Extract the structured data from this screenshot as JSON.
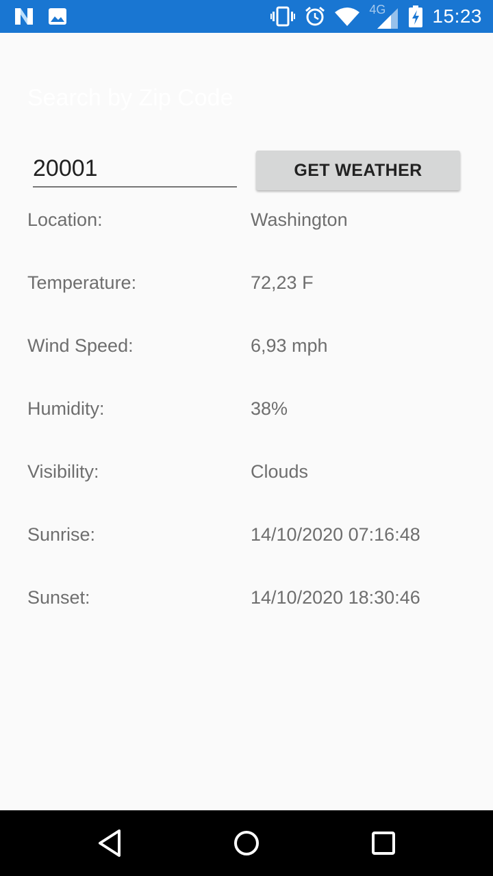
{
  "status_bar": {
    "time": "15:23",
    "network": "4G",
    "icons": [
      "n-logo-icon",
      "image-icon",
      "vibrate-icon",
      "alarm-icon",
      "wifi-icon",
      "signal-icon",
      "battery-charging-icon"
    ],
    "color": "#1976d2"
  },
  "search": {
    "title": "Search by Zip Code",
    "zip_value": "20001",
    "button_label": "GET WEATHER"
  },
  "weather": {
    "rows": [
      {
        "label": "Location:",
        "value": "Washington"
      },
      {
        "label": "Temperature:",
        "value": "72,23 F"
      },
      {
        "label": "Wind Speed:",
        "value": "6,93 mph"
      },
      {
        "label": "Humidity:",
        "value": "38%"
      },
      {
        "label": "Visibility:",
        "value": "Clouds"
      },
      {
        "label": "Sunrise:",
        "value": "14/10/2020 07:16:48"
      },
      {
        "label": "Sunset:",
        "value": "14/10/2020 18:30:46"
      }
    ]
  },
  "nav_bar": {
    "icons": [
      "back-icon",
      "home-icon",
      "recents-icon"
    ]
  }
}
